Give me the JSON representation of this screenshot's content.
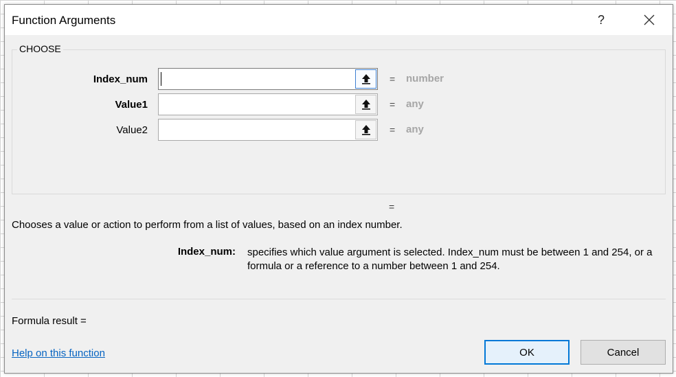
{
  "dialog": {
    "title": "Function Arguments",
    "help_symbol": "?",
    "close_icon": "close-icon"
  },
  "function": {
    "name": "CHOOSE",
    "arguments": [
      {
        "label": "Index_num",
        "value": "",
        "type": "number",
        "bold": true
      },
      {
        "label": "Value1",
        "value": "",
        "type": "any",
        "bold": true
      },
      {
        "label": "Value2",
        "value": "",
        "type": "any",
        "bold": false
      }
    ],
    "equals": "=",
    "result_equals": "=",
    "description": "Chooses a value or action to perform from a list of values, based on an index number.",
    "arg_help_name": "Index_num:",
    "arg_help_text": "specifies which value argument is selected. Index_num must be between 1 and 254, or a formula or a reference to a number between 1 and 254."
  },
  "footer": {
    "formula_result": "Formula result =",
    "help_link": "Help on this function",
    "ok_label": "OK",
    "cancel_label": "Cancel"
  },
  "colors": {
    "accent": "#0078d7",
    "link": "#0563c1",
    "type_hint": "#a6a6a6"
  }
}
